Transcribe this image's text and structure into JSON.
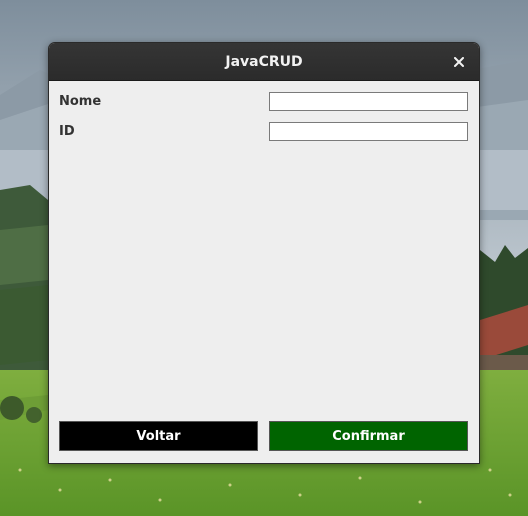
{
  "window": {
    "title": "JavaCRUD",
    "close_icon": "close-icon"
  },
  "form": {
    "nome_label": "Nome",
    "nome_value": "",
    "id_label": "ID",
    "id_value": ""
  },
  "buttons": {
    "voltar_label": "Voltar",
    "voltar_color": "#000000",
    "confirmar_label": "Confirmar",
    "confirmar_color": "#006400"
  },
  "desktop": {
    "wallpaper": "mountain-meadow-landscape"
  }
}
